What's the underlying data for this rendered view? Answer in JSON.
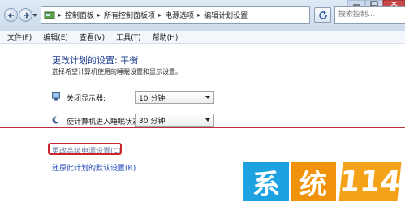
{
  "breadcrumb": [
    "控制面板",
    "所有控制面板项",
    "电源选项",
    "编辑计划设置"
  ],
  "search": {
    "placeholder": "搜索控制..."
  },
  "menu": [
    "文件(F)",
    "编辑(E)",
    "查看(V)",
    "工具(T)",
    "帮助(H)"
  ],
  "page": {
    "title": "更改计划的设置: 平衡",
    "description": "选择希望计算机使用的睡眠设置和显示设置。",
    "display_off_label": "关闭显示器:",
    "display_off_value": "10 分钟",
    "sleep_label": "使计算机进入睡眠状态:",
    "sleep_value": "30 分钟",
    "advanced_link": "更改高级电源设置(C)",
    "restore_link": "还原此计划的默认设置(R)"
  },
  "watermark": {
    "char1": "系",
    "char2": "统",
    "number": "114"
  },
  "colors": {
    "accent": "#c8282c",
    "link": "#1a44b8",
    "title": "#1e3f8c"
  }
}
